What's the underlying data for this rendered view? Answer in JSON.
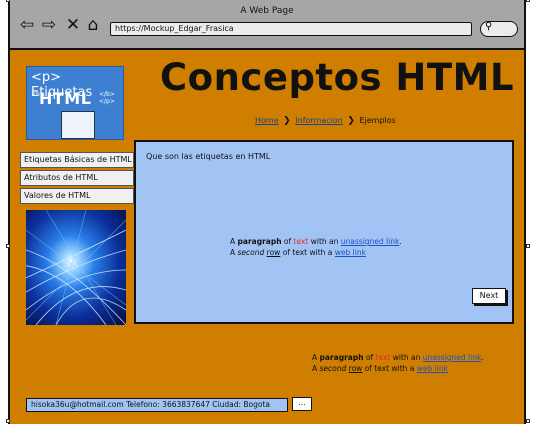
{
  "window": {
    "title": "A Web Page"
  },
  "browser": {
    "url": "https://Mockup_Edgar_Frasica",
    "search_icon": "search-icon",
    "nav_icons": [
      "back-arrow-icon",
      "forward-arrow-icon",
      "close-icon",
      "home-icon"
    ]
  },
  "header": {
    "title": "Conceptos HTML",
    "logo": {
      "line1": "<p> Etiquetas",
      "line2": "HTML",
      "left": "<b>",
      "right": "</b></p>"
    }
  },
  "breadcrumb": {
    "items": [
      "Home",
      "Informacion",
      "Ejemplos"
    ]
  },
  "sidebar": {
    "items": [
      {
        "label": "Etiquetas Básicas de HTML"
      },
      {
        "label": "Atributos de HTML"
      },
      {
        "label": "Valores de HTML"
      }
    ]
  },
  "content": {
    "question": "Que son las etiquetas en HTML",
    "paragraph": {
      "l1_a": "A ",
      "l1_bold": "paragraph",
      "l1_b": " of ",
      "l1_red": "text",
      "l1_c": " with an ",
      "l1_link": "unassigned link",
      "l1_d": ".",
      "l2_a": "A ",
      "l2_em": "second",
      "l2_b": " ",
      "l2_u": "row",
      "l2_c": " of text with a ",
      "l2_link": "web link"
    },
    "next_button": "Next"
  },
  "footer": {
    "contact": "hisoka36u@hotmail.com Telefono: 3663837647  Ciudad: Bogota",
    "button": "..."
  },
  "colors": {
    "page_bg": "#cf7e00",
    "panel_bg": "#a1c4f5",
    "browser_bar": "#a6a6a6",
    "link": "#1f52c4",
    "highlight_text": "#e22d2d"
  }
}
